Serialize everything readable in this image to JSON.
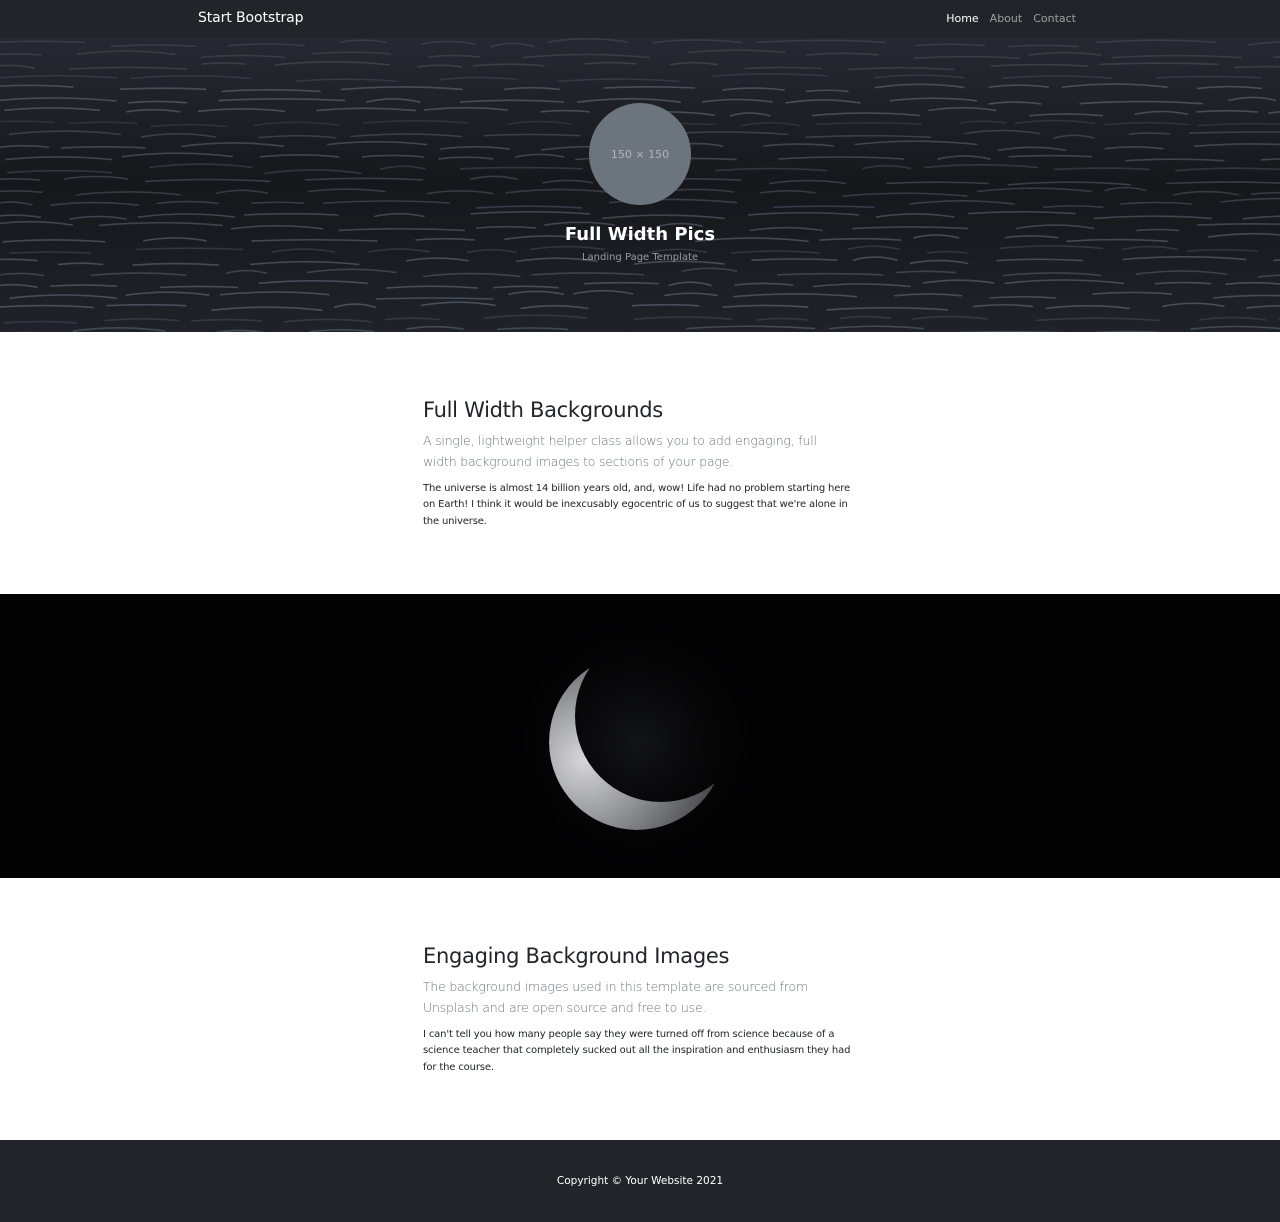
{
  "navbar": {
    "brand": "Start Bootstrap",
    "links": [
      {
        "label": "Home",
        "active": true
      },
      {
        "label": "About",
        "active": false
      },
      {
        "label": "Contact",
        "active": false
      }
    ]
  },
  "hero": {
    "avatar_text": "150 × 150",
    "title": "Full Width Pics",
    "subtitle": "Landing Page Template"
  },
  "sections": [
    {
      "heading": "Full Width Backgrounds",
      "lead": "A single, lightweight helper class allows you to add engaging, full width background images to sections of your page.",
      "body": "The universe is almost 14 billion years old, and, wow! Life had no problem starting here on Earth! I think it would be inexcusably egocentric of us to suggest that we're alone in the universe."
    },
    {
      "heading": "Engaging Background Images",
      "lead": "The background images used in this template are sourced from Unsplash and are open source and free to use.",
      "body": "I can't tell you how many people say they were turned off from science because of a science teacher that completely sucked out all the inspiration and enthusiasm they had for the course."
    }
  ],
  "footer": {
    "copyright": "Copyright © Your Website 2021"
  },
  "colors": {
    "navbar_bg": "#212529",
    "avatar_bg": "#6c757d",
    "lead_text": "#6c757d"
  }
}
